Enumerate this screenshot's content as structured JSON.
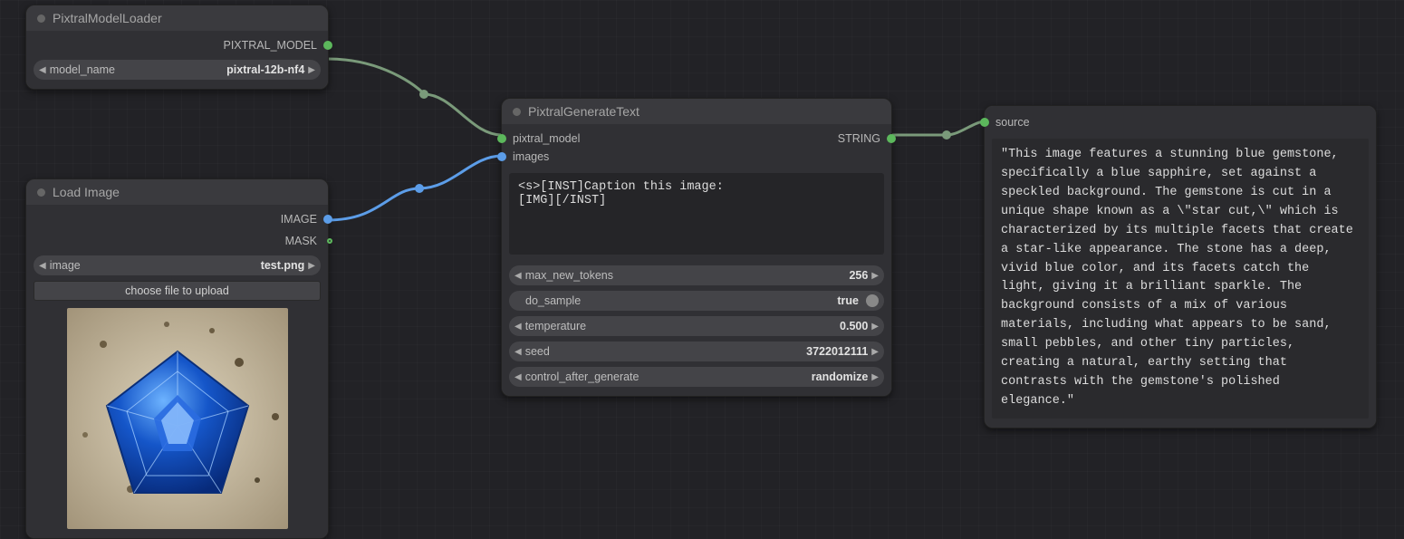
{
  "nodes": {
    "pixtral_loader": {
      "title": "PixtralModelLoader",
      "output_label": "PIXTRAL_MODEL",
      "param_name_label": "model_name",
      "model_name": "pixtral-12b-nf4"
    },
    "load_image": {
      "title": "Load Image",
      "output_image": "IMAGE",
      "output_mask": "MASK",
      "param_image_label": "image",
      "image_file": "test.png",
      "choose_btn": "choose file to upload"
    },
    "generate": {
      "title": "PixtralGenerateText",
      "in_model": "pixtral_model",
      "in_images": "images",
      "out_string": "STRING",
      "prompt": "<s>[INST]Caption this image:\n[IMG][/INST]",
      "params": {
        "max_new_tokens_label": "max_new_tokens",
        "max_new_tokens": "256",
        "do_sample_label": "do_sample",
        "do_sample": "true",
        "temperature_label": "temperature",
        "temperature": "0.500",
        "seed_label": "seed",
        "seed": "3722012111",
        "control_label": "control_after_generate",
        "control": "randomize"
      }
    },
    "result": {
      "title": "source",
      "text": "\"This image features a stunning blue gemstone, specifically a blue sapphire, set against a speckled background. The gemstone is cut in a unique shape known as a \\\"star cut,\\\" which is characterized by its multiple facets that create a star-like appearance. The stone has a deep, vivid blue color, and its facets catch the light, giving it a brilliant sparkle. The background consists of a mix of various materials, including what appears to be sand, small pebbles, and other tiny particles, creating a natural, earthy setting that contrasts with the gemstone's polished elegance.\""
    }
  },
  "colors": {
    "wire_green": "#7a9a7a",
    "wire_blue": "#5c9de8"
  }
}
